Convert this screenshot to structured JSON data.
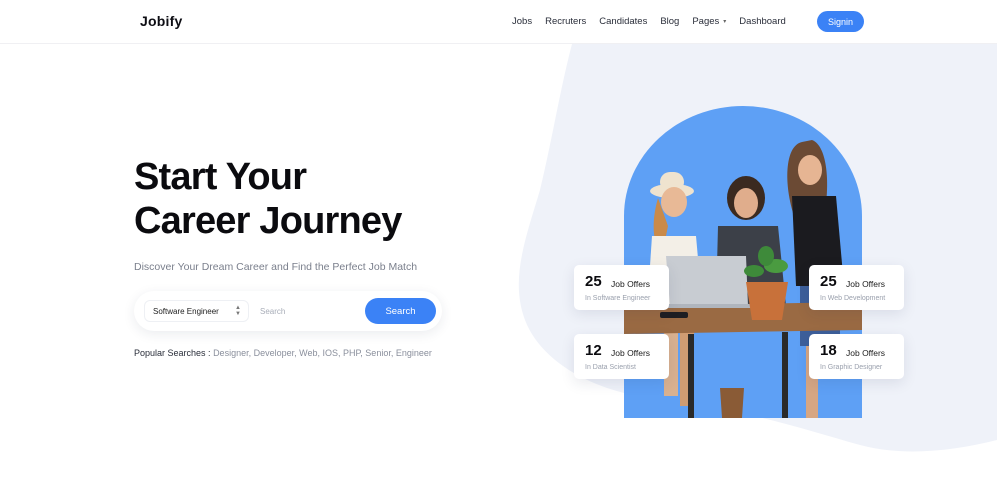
{
  "header": {
    "logo": "Jobify",
    "nav": [
      {
        "label": "Jobs"
      },
      {
        "label": "Recruters"
      },
      {
        "label": "Candidates"
      },
      {
        "label": "Blog"
      },
      {
        "label": "Pages",
        "has_dropdown": true
      },
      {
        "label": "Dashboard"
      }
    ],
    "signin_label": "Signin"
  },
  "hero": {
    "title_line1": "Start Your",
    "title_line2": "Career Journey",
    "subtitle": "Discover Your Dream Career and Find the Perfect Job Match"
  },
  "search": {
    "category_selected": "Software Engineer",
    "input_placeholder": "Search",
    "button_label": "Search"
  },
  "popular": {
    "label": "Popular Searches :",
    "terms": "Designer, Developer, Web, IOS, PHP, Senior, Engineer"
  },
  "stats": [
    {
      "number": "25",
      "label": "Job Offers",
      "sub": "In Software Engineer"
    },
    {
      "number": "25",
      "label": "Job Offers",
      "sub": "In Web Development"
    },
    {
      "number": "12",
      "label": "Job Offers",
      "sub": "In Data Scientist"
    },
    {
      "number": "18",
      "label": "Job Offers",
      "sub": "In Graphic Designer"
    }
  ],
  "colors": {
    "accent": "#3b82f6",
    "blob": "#eff2f9",
    "photo_bg": "#5ea0f5"
  },
  "icons": {
    "select_arrows": "chevron-up-down-icon",
    "nav_caret": "chevron-down-icon"
  }
}
